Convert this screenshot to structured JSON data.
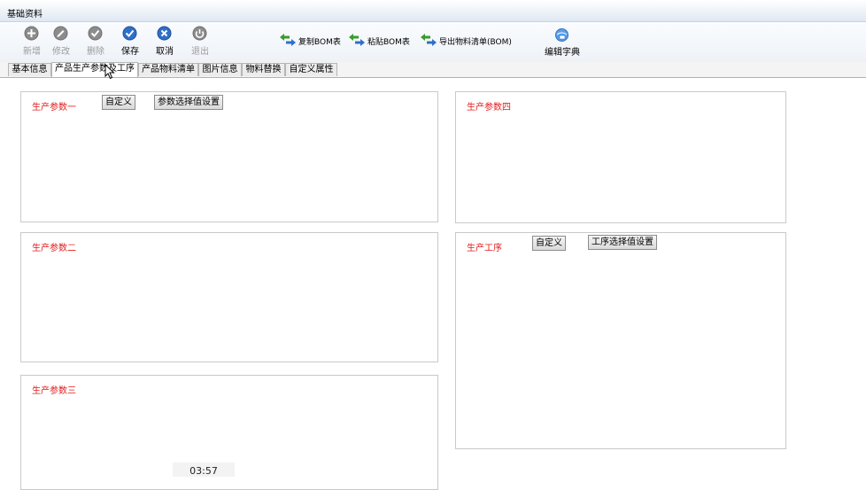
{
  "window": {
    "title": "基础资料"
  },
  "toolbar": {
    "buttons": [
      {
        "label": "新增",
        "icon": "plus-circle-icon",
        "enabled": false
      },
      {
        "label": "修改",
        "icon": "edit-icon",
        "enabled": false
      },
      {
        "label": "删除",
        "icon": "delete-icon",
        "enabled": false
      },
      {
        "label": "保存",
        "icon": "save-check-icon",
        "enabled": true
      },
      {
        "label": "取消",
        "icon": "cancel-x-icon",
        "enabled": true
      },
      {
        "label": "退出",
        "icon": "exit-icon",
        "enabled": false
      }
    ],
    "copy_bom": "复制BOM表",
    "paste_bom": "粘贴BOM表",
    "export_bom": "导出物料清单(BOM)",
    "edit_dict": "编辑字典"
  },
  "tabs": [
    "基本信息",
    "产品生产参数及工序",
    "产品物料清单",
    "图片信息",
    "物料替换",
    "自定义属性"
  ],
  "active_tab": "产品生产参数及工序",
  "panels": {
    "param1": {
      "title": "生产参数一",
      "custom_btn": "自定义",
      "select_btn": "参数选择值设置"
    },
    "param2": {
      "title": "生产参数二"
    },
    "param3": {
      "title": "生产参数三"
    },
    "param4": {
      "title": "生产参数四"
    },
    "process": {
      "title": "生产工序",
      "custom_btn": "自定义",
      "select_btn": "工序选择值设置"
    }
  },
  "overlay": {
    "clock": "03:57"
  },
  "colors": {
    "panel_title": "#e21d1d",
    "blue_icon": "#2f6fc9",
    "green_arrow": "#3a9b2c"
  }
}
